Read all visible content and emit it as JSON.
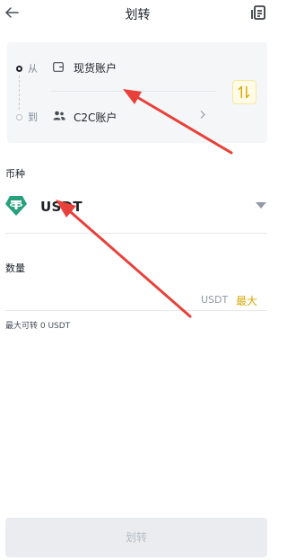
{
  "header": {
    "title": "划转",
    "back_icon": "arrow-left-icon",
    "record_icon": "transfer-record-icon"
  },
  "transfer": {
    "from_label": "从",
    "from_account": "现货账户",
    "to_label": "到",
    "to_account": "C2C账户",
    "swap_icon": "swap-vertical-icon"
  },
  "coin": {
    "section_label": "币种",
    "name": "USDT",
    "icon": "tether-icon"
  },
  "amount": {
    "section_label": "数量",
    "unit": "USDT",
    "max_label": "最大",
    "available_text": "最大可转 0 USDT"
  },
  "submit": {
    "label": "划转"
  },
  "colors": {
    "accent": "#f0b90b",
    "arrow_annotation": "#e8403a",
    "tether": "#26a17b"
  }
}
